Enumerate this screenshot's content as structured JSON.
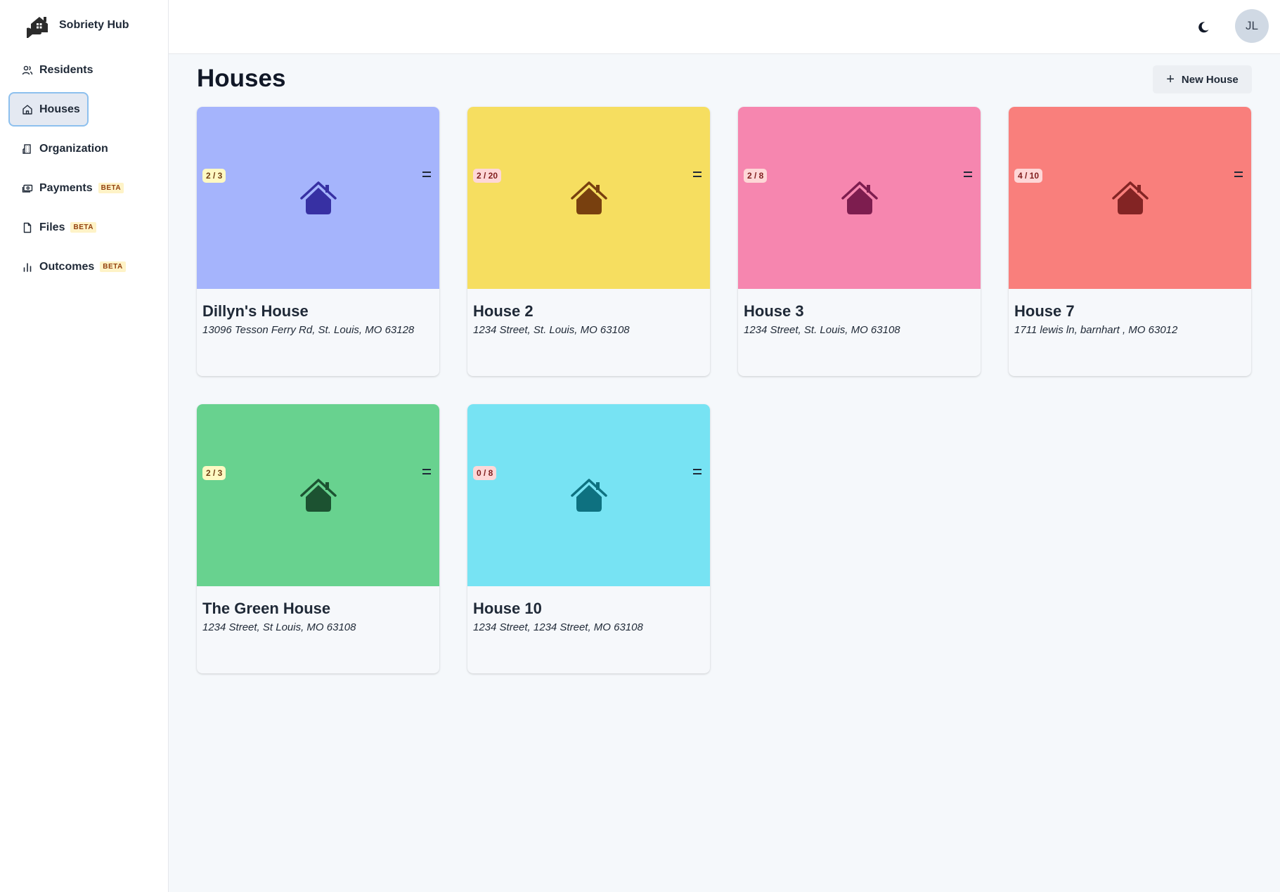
{
  "app": {
    "name": "Sobriety Hub"
  },
  "sidebar": {
    "items": [
      {
        "label": "Residents",
        "icon": "users-icon",
        "beta": ""
      },
      {
        "label": "Houses",
        "icon": "home-icon",
        "beta": "",
        "active": true
      },
      {
        "label": "Organization",
        "icon": "building-icon",
        "beta": ""
      },
      {
        "label": "Payments",
        "icon": "payments-icon",
        "beta": "BETA"
      },
      {
        "label": "Files",
        "icon": "file-icon",
        "beta": "BETA"
      },
      {
        "label": "Outcomes",
        "icon": "bar-chart-icon",
        "beta": "BETA"
      }
    ]
  },
  "header": {
    "theme_icon": "moon-icon",
    "avatar_initials": "JL"
  },
  "main": {
    "title": "Houses",
    "new_button_label": "New House",
    "houses": [
      {
        "name": "Dillyn's House",
        "address": "13096 Tesson Ferry Rd, St. Louis, MO 63128",
        "occupancy": "2 / 3",
        "occupancy_tone": "yellow",
        "bg_color": "#a5b4fc",
        "icon_color": "#3730a3"
      },
      {
        "name": "House 2",
        "address": "1234 Street, St. Louis, MO 63108",
        "occupancy": "2 / 20",
        "occupancy_tone": "red",
        "bg_color": "#f6de60",
        "icon_color": "#78400f"
      },
      {
        "name": "House 3",
        "address": "1234 Street, St. Louis, MO 63108",
        "occupancy": "2 / 8",
        "occupancy_tone": "red",
        "bg_color": "#f686af",
        "icon_color": "#7d1d4f"
      },
      {
        "name": "House 7",
        "address": "1711 lewis ln, barnhart , MO 63012",
        "occupancy": "4 / 10",
        "occupancy_tone": "red",
        "bg_color": "#f97f7c",
        "icon_color": "#832424"
      },
      {
        "name": "The Green House",
        "address": "1234 Street, St Louis, MO 63108",
        "occupancy": "2 / 3",
        "occupancy_tone": "yellow",
        "bg_color": "#68d28f",
        "icon_color": "#1c5231"
      },
      {
        "name": "House 10",
        "address": "1234 Street, 1234 Street, MO 63108",
        "occupancy": "0 / 8",
        "occupancy_tone": "red",
        "bg_color": "#77e3f3",
        "icon_color": "#0e7180"
      }
    ]
  }
}
